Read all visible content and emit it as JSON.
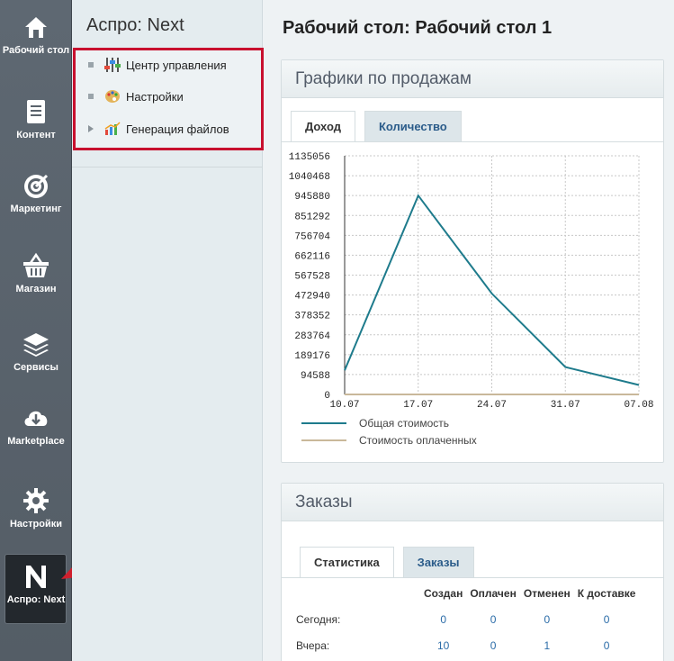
{
  "sidebar": {
    "items": [
      {
        "label": "Рабочий стол",
        "icon": "home-icon"
      },
      {
        "label": "Контент",
        "icon": "document-icon"
      },
      {
        "label": "Маркетинг",
        "icon": "target-icon"
      },
      {
        "label": "Магазин",
        "icon": "basket-icon"
      },
      {
        "label": "Сервисы",
        "icon": "layers-icon"
      },
      {
        "label": "Marketplace",
        "icon": "cloud-download-icon"
      },
      {
        "label": "Настройки",
        "icon": "gear-icon"
      },
      {
        "label": "Аспро: Next",
        "icon": "aspro-logo-icon"
      }
    ]
  },
  "menu": {
    "title": "Аспро: Next",
    "items": [
      {
        "label": "Центр управления",
        "icon": "control-center-icon"
      },
      {
        "label": "Настройки",
        "icon": "palette-icon"
      },
      {
        "label": "Генерация файлов",
        "icon": "chart-icon"
      }
    ]
  },
  "page": {
    "title": "Рабочий стол: Рабочий стол 1"
  },
  "sales": {
    "title": "Графики по продажам",
    "tabs": [
      "Доход",
      "Количество"
    ],
    "legend": [
      "Общая стоимость",
      "Стоимость оплаченных"
    ]
  },
  "chart_data": {
    "type": "line",
    "x": [
      "10.07",
      "17.07",
      "24.07",
      "31.07",
      "07.08"
    ],
    "xticks": [
      "10.07",
      "17.07",
      "24.07",
      "31.07",
      "07.08"
    ],
    "yticks": [
      0,
      94588,
      189176,
      283764,
      378352,
      472940,
      567528,
      662116,
      756704,
      851292,
      945880,
      1040468,
      1135056
    ],
    "ylim": [
      0,
      1135056
    ],
    "series": [
      {
        "name": "Общая стоимость",
        "color": "#1e7b8c",
        "points": [
          [
            0,
            115000
          ],
          [
            1,
            945880
          ],
          [
            2,
            480000
          ],
          [
            3,
            130000
          ],
          [
            4,
            45000
          ]
        ]
      },
      {
        "name": "Стоимость оплаченных",
        "color": "#c9b89a",
        "points": [
          [
            0,
            0
          ],
          [
            1,
            0
          ],
          [
            2,
            0
          ],
          [
            3,
            0
          ],
          [
            4,
            0
          ]
        ]
      }
    ],
    "grid": true
  },
  "orders": {
    "title": "Заказы",
    "tabs": [
      "Статистика",
      "Заказы"
    ],
    "columns": [
      "Создан",
      "Оплачен",
      "Отменен",
      "К доставке"
    ],
    "rows": [
      {
        "label": "Сегодня:",
        "values": [
          "0",
          "0",
          "0",
          "0"
        ]
      },
      {
        "label": "Вчера:",
        "values": [
          "10",
          "0",
          "1",
          "0"
        ]
      }
    ]
  },
  "colors": {
    "accent": "#2b6ca8",
    "highlight": "#c8102e",
    "arrow": "#d0202e"
  }
}
